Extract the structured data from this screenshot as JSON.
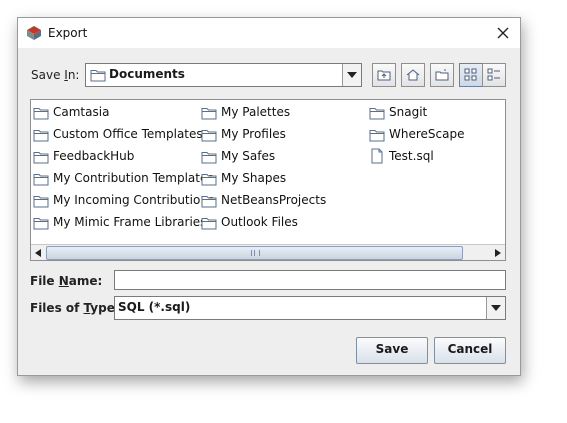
{
  "window": {
    "title": "Export"
  },
  "save_in": {
    "label_before": "Save ",
    "label_mnemonic": "I",
    "label_after": "n:",
    "value": "Documents"
  },
  "toolbar": {
    "buttons": [
      {
        "icon": "up-one-level-icon"
      },
      {
        "icon": "home-icon"
      },
      {
        "icon": "new-folder-icon"
      },
      {
        "icon": "list-view-icon",
        "selected": true
      },
      {
        "icon": "details-view-icon"
      }
    ]
  },
  "files": [
    {
      "name": "Camtasia",
      "type": "folder"
    },
    {
      "name": "Custom Office Templates",
      "type": "folder"
    },
    {
      "name": "FeedbackHub",
      "type": "folder"
    },
    {
      "name": "My Contribution Templates",
      "type": "folder"
    },
    {
      "name": "My Incoming Contributions",
      "type": "folder"
    },
    {
      "name": "My Mimic Frame Libraries",
      "type": "folder"
    },
    {
      "name": "My Palettes",
      "type": "folder"
    },
    {
      "name": "My Profiles",
      "type": "folder"
    },
    {
      "name": "My Safes",
      "type": "folder"
    },
    {
      "name": "My Shapes",
      "type": "folder"
    },
    {
      "name": "NetBeansProjects",
      "type": "folder"
    },
    {
      "name": "Outlook Files",
      "type": "folder"
    },
    {
      "name": "Snagit",
      "type": "folder"
    },
    {
      "name": "WhereScape",
      "type": "folder"
    },
    {
      "name": "Test.sql",
      "type": "file"
    }
  ],
  "file_name": {
    "label_before": "File ",
    "label_mnemonic": "N",
    "label_after": "ame:",
    "value": ""
  },
  "files_of_type": {
    "label_before": "Files of ",
    "label_mnemonic": "T",
    "label_after": "ype:",
    "value": "SQL (*.sql)"
  },
  "buttons": {
    "save": "Save",
    "cancel": "Cancel"
  },
  "colors": {
    "dialog_bg": "#eeeeee",
    "folder_stroke": "#5a6f8e",
    "button_border": "#7f8fa4"
  }
}
